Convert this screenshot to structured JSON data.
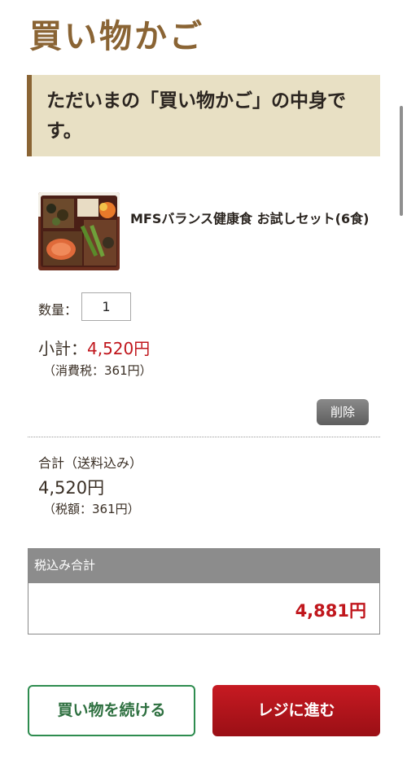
{
  "page": {
    "title": "買い物かご"
  },
  "notice": {
    "text": "ただいまの「買い物かご」の中身です。"
  },
  "item": {
    "image": "bento-box-thumbnail",
    "name": "MFSバランス健康食 お試しセット(6食)",
    "quantity_label": "数量：",
    "quantity_value": "1",
    "subtotal_label": "小計：",
    "subtotal_price": "4,520円",
    "tax_note": "（消費税：361円）",
    "delete_label": "削除"
  },
  "total": {
    "label": "合計（送料込み）",
    "value": "4,520円",
    "tax_note": "（税額：361円）"
  },
  "grand_total": {
    "header": "税込み合計",
    "value": "4,881円"
  },
  "actions": {
    "continue_label": "買い物を続ける",
    "register_label": "レジに進む"
  },
  "colors": {
    "brand_brown": "#8a6434",
    "price_red": "#c0161c",
    "notice_bg": "#e8e0c4",
    "continue_green": "#2e8c4f"
  }
}
